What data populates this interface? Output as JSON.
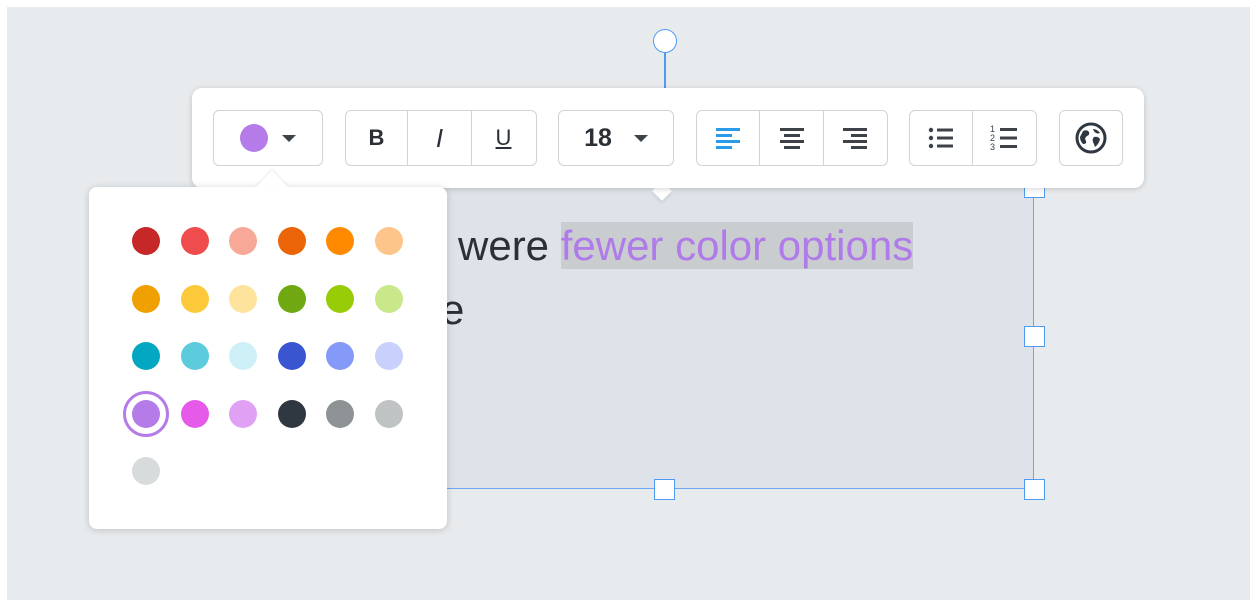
{
  "textbox": {
    "line1_plain": "were",
    "line1_highlight": "fewer color options",
    "line2": "e",
    "highlight_color": "#b07be8"
  },
  "toolbar": {
    "color_selected": "#b57be8",
    "bold_label": "B",
    "italic_label": "I",
    "underline_label": "U",
    "font_size": "18",
    "align_left_active": true,
    "accent": "#2a9be6",
    "icons": [
      "color-picker",
      "bold",
      "italic",
      "underline",
      "align-left",
      "align-center",
      "align-right",
      "bullet-list",
      "numbered-list",
      "link-globe"
    ]
  },
  "palette": {
    "selected": "#b57be8",
    "colors": [
      [
        "#c62828",
        "#ef4d4d",
        "#f8a897",
        "#ec6408",
        "#ff8a00",
        "#fdc58a"
      ],
      [
        "#f0a000",
        "#fcc93a",
        "#fde39c",
        "#6fa810",
        "#97cc06",
        "#c8e88a"
      ],
      [
        "#03a7c1",
        "#5ccbdb",
        "#cdf0f6",
        "#3a55d0",
        "#8499f8",
        "#c8d0fc"
      ],
      [
        "#b57be8",
        "#e65ae9",
        "#e0a1f5",
        "#2f3841",
        "#8d9295",
        "#c0c3c4"
      ],
      [
        "#d8dbdc"
      ]
    ]
  }
}
